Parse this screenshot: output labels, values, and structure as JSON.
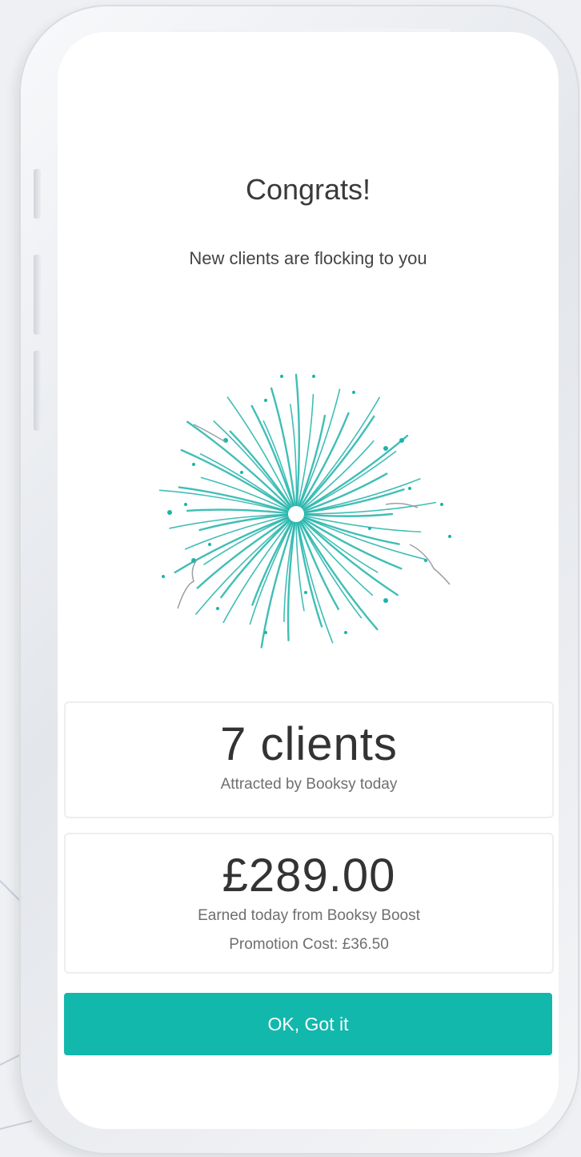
{
  "screen": {
    "title": "Congrats!",
    "subtitle": "New clients are flocking to you",
    "illustration_icon": "fireworks-icon"
  },
  "stats": {
    "clients": {
      "value": "7 clients",
      "caption": "Attracted by Booksy today"
    },
    "earnings": {
      "value": "£289.00",
      "caption": "Earned today from Booksy Boost",
      "promotion_cost": "Promotion Cost: £36.50"
    }
  },
  "actions": {
    "ok_label": "OK, Got it"
  },
  "colors": {
    "accent": "#12b8ac",
    "firework": "#1fb3a9"
  }
}
